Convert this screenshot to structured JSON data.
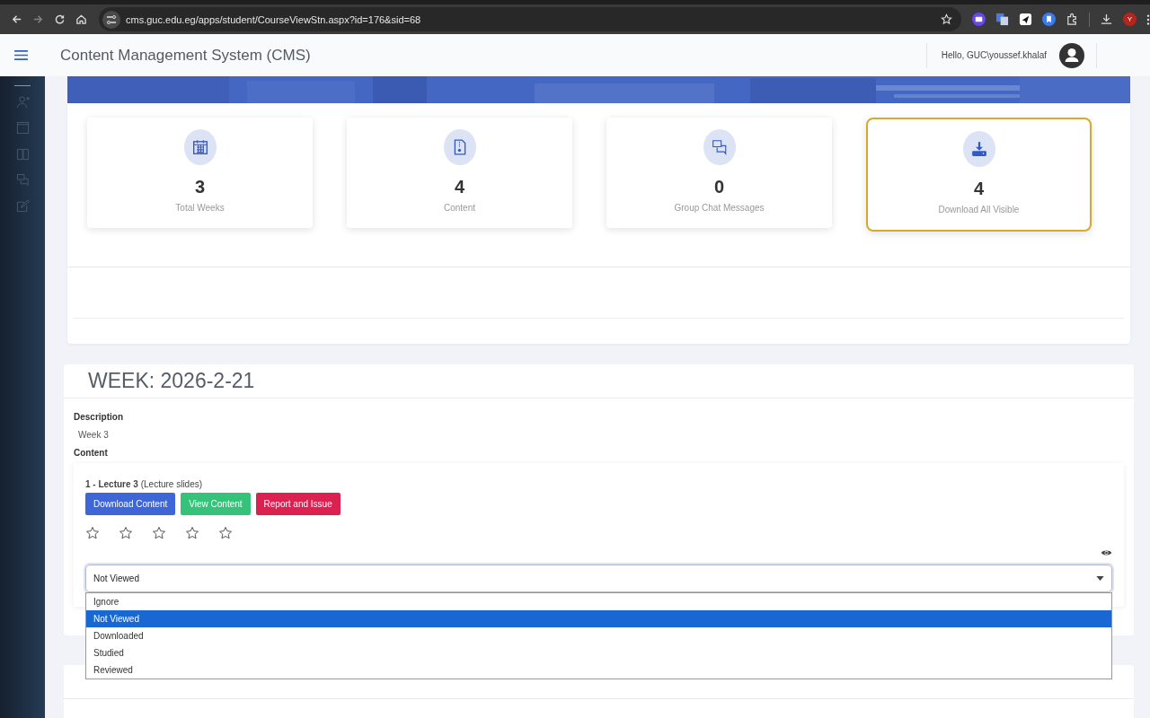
{
  "browser": {
    "url": "cms.guc.edu.eg/apps/student/CourseViewStn.aspx?id=176&sid=68",
    "forward_disabled": true,
    "profile_initial": "Y"
  },
  "header": {
    "title": "Content Management System (CMS)",
    "greeting": "Hello, GUC\\youssef.khalaf"
  },
  "stats": [
    {
      "kind": "calendar",
      "value": "3",
      "label": "Total Weeks",
      "highlighted": false
    },
    {
      "kind": "file",
      "value": "4",
      "label": "Content",
      "highlighted": false
    },
    {
      "kind": "chat",
      "value": "0",
      "label": "Group Chat Messages",
      "highlighted": false
    },
    {
      "kind": "download",
      "value": "4",
      "label": "Download All Visible",
      "highlighted": true
    }
  ],
  "weeks": [
    {
      "title": "WEEK: 2026-2-21",
      "description_label": "Description",
      "description": "Week 3",
      "content_label": "Content",
      "items": [
        {
          "title": "**1 - Lecture 3** (Lecture slides)",
          "buttons": [
            {
              "label": "Download Content",
              "kind": "download"
            },
            {
              "label": "View Content",
              "kind": "view"
            },
            {
              "label": "Report and Issue",
              "kind": "report"
            }
          ],
          "stars": 0,
          "status": {
            "value": "Not Viewed",
            "expanded": true,
            "options": [
              {
                "label": "Ignore",
                "selected": false
              },
              {
                "label": "Not Viewed",
                "selected": true
              },
              {
                "label": "Downloaded",
                "selected": false
              },
              {
                "label": "Studied",
                "selected": false
              },
              {
                "label": "Reviewed",
                "selected": false
              }
            ]
          }
        }
      ]
    }
  ]
}
